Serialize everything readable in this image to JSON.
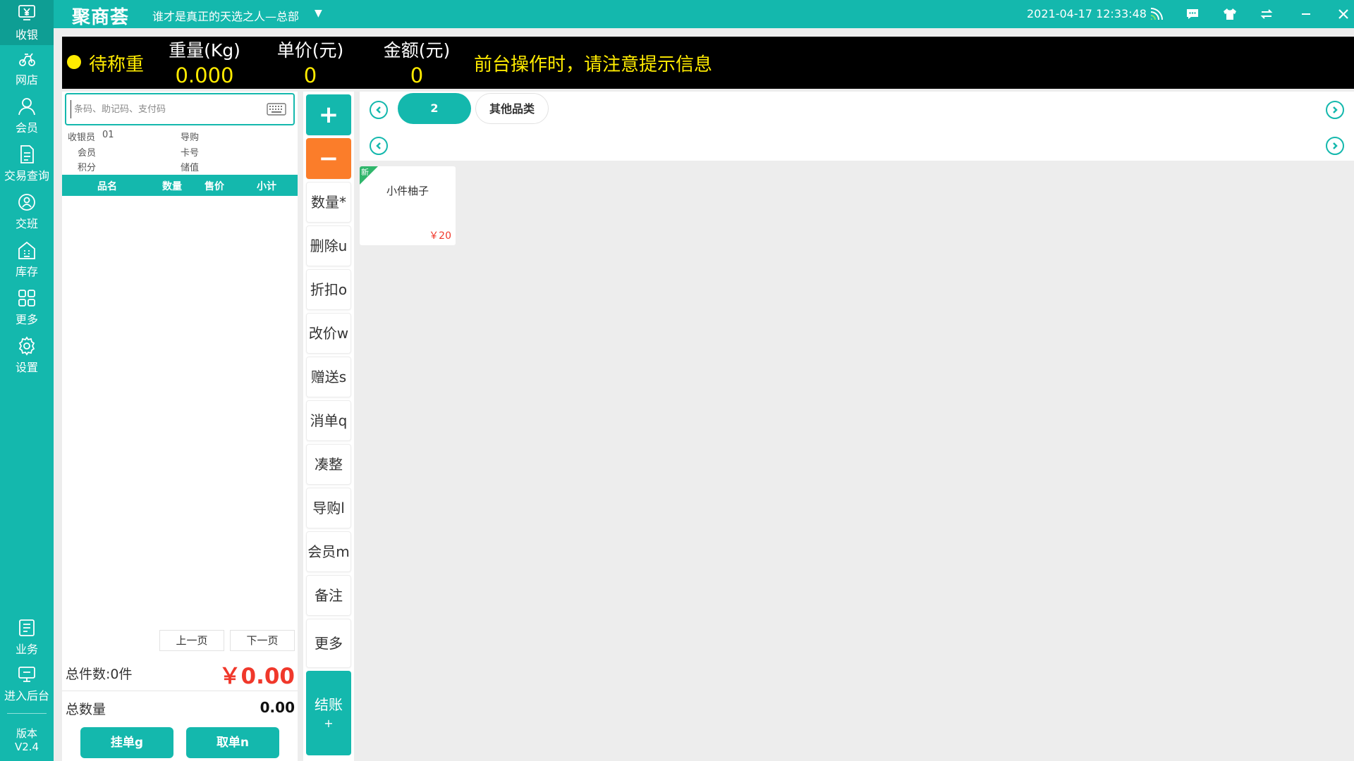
{
  "sidebar": {
    "items": [
      {
        "label": "收银",
        "icon": "cashier-icon"
      },
      {
        "label": "网店",
        "icon": "online-store-icon"
      },
      {
        "label": "会员",
        "icon": "member-icon"
      },
      {
        "label": "交易查询",
        "icon": "transaction-query-icon"
      },
      {
        "label": "交班",
        "icon": "shift-handover-icon"
      },
      {
        "label": "库存",
        "icon": "inventory-icon"
      },
      {
        "label": "更多",
        "icon": "more-grid-icon"
      },
      {
        "label": "设置",
        "icon": "settings-gear-icon"
      },
      {
        "label": "业务",
        "icon": "business-icon"
      },
      {
        "label": "进入后台",
        "icon": "backend-monitor-icon"
      }
    ],
    "version_label": "版本",
    "version": "V2.4"
  },
  "titlebar": {
    "logo": "聚商荟",
    "store_name": "谁才是真正的天选之人—总部",
    "datetime": "2021-04-17 12:33:48"
  },
  "scale": {
    "status": "待称重",
    "weight_label": "重量(Kg)",
    "weight": "0.000",
    "unit_price_label": "单价(元)",
    "unit_price": "0",
    "amount_label": "金额(元)",
    "amount": "0",
    "notice": "前台操作时，请注意提示信息"
  },
  "order": {
    "search_placeholder": "条码、助记码、支付码",
    "cashier_label": "收银员",
    "cashier_id": "01",
    "guide_label": "导购",
    "member_label": "会员",
    "card_label": "卡号",
    "points_label": "积分",
    "balance_label": "储值",
    "columns": [
      "品名",
      "数量",
      "售价",
      "小计"
    ],
    "prev_page": "上一页",
    "next_page": "下一页",
    "total_items": "总件数:0件",
    "total_amount": "￥0.00",
    "total_qty_label": "总数量",
    "total_qty": "0.00",
    "hold_button": "挂单g",
    "retrieve_button": "取单n"
  },
  "functions": {
    "plus": "+",
    "minus": "−",
    "buttons": [
      "数量*",
      "删除u",
      "折扣o",
      "改价w",
      "赠送s",
      "消单q",
      "凑整",
      "导购l",
      "会员m",
      "备注",
      "更多"
    ],
    "checkout_label": "结账",
    "checkout_key": "+"
  },
  "categories": {
    "tabs": [
      "2",
      "其他品类"
    ]
  },
  "products": [
    {
      "badge": "新",
      "name": "小件柚子",
      "price": "￥20"
    }
  ],
  "colors": {
    "primary": "#14b8ad",
    "accent_orange": "#fb7d2a",
    "price_red": "#f0382b",
    "scale_yellow": "#ffeb00"
  }
}
